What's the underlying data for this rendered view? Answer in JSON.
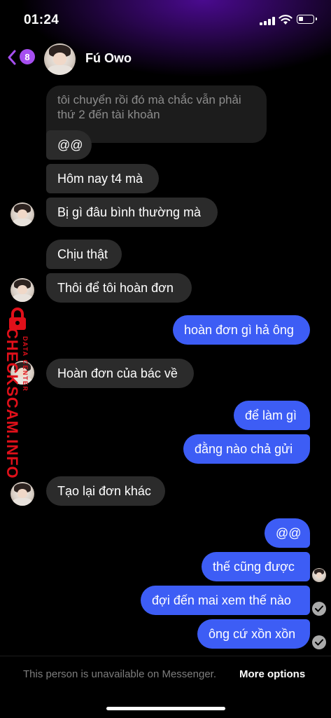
{
  "status_bar": {
    "time": "01:24"
  },
  "header": {
    "back_badge": "8",
    "contact_name": "Fú Owo"
  },
  "messages": {
    "m1": "tôi chuyển rồi đó mà chắc vẫn phải thứ 2 đến tài khoản",
    "m2": "@@",
    "m3": "Hôm nay t4 mà",
    "m4": "Bị gì đâu bình thường mà",
    "m5": "Chịu thật",
    "m6": "Thôi để tôi hoàn đơn",
    "m7": "hoàn đơn gì hả ông",
    "m8": "Hoàn đơn của bác về",
    "m9": "để làm gì",
    "m10": "đằng nào chả gửi",
    "m11": "Tạo lại đơn khác",
    "m12": "@@",
    "m13": "thế cũng được",
    "m14": "đợi đến mai xem thế nào",
    "m15": "ông cứ xồn xồn"
  },
  "watermark": {
    "main": "CHECKSCAM.INFO",
    "sub": "DATA CENTER"
  },
  "footer": {
    "notice": "This person is unavailable on Messenger.",
    "link": "More options"
  },
  "colors": {
    "outgoing": "#3d5df5",
    "incoming": "#2b2b2b",
    "badge": "#a64ff0",
    "watermark": "#e0101a"
  }
}
